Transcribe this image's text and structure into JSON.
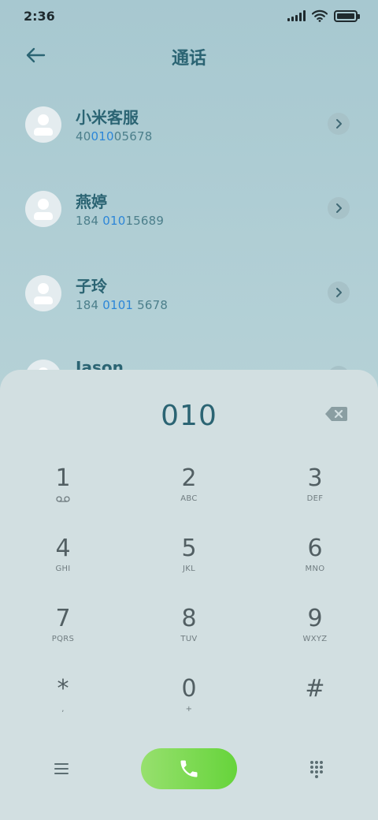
{
  "status_bar": {
    "time": "2:36",
    "icons": [
      "signal-icon",
      "wifi-icon",
      "battery-icon"
    ],
    "signal_bars": 5,
    "battery_level": 1.0
  },
  "header": {
    "title": "通话",
    "back_icon": "arrow-left-icon"
  },
  "contacts": [
    {
      "name": "小米客服",
      "number_parts": [
        "40",
        "010",
        "05678"
      ],
      "highlight_index": 1
    },
    {
      "name": "燕婷",
      "number_parts": [
        "184 ",
        "010",
        "15689"
      ],
      "highlight_index": 1
    },
    {
      "name": "子玲",
      "number_parts": [
        "184 ",
        "0101",
        " 5678"
      ],
      "highlight_index": 1
    },
    {
      "name": "Jason",
      "number_parts": [
        "",
        "",
        ""
      ],
      "highlight_index": 1
    }
  ],
  "dialer": {
    "input": "010",
    "keys": [
      {
        "digit": "1",
        "sub": "",
        "sub_icon": "voicemail-icon"
      },
      {
        "digit": "2",
        "sub": "ABC"
      },
      {
        "digit": "3",
        "sub": "DEF"
      },
      {
        "digit": "4",
        "sub": "GHI"
      },
      {
        "digit": "5",
        "sub": "JKL"
      },
      {
        "digit": "6",
        "sub": "MNO"
      },
      {
        "digit": "7",
        "sub": "PQRS"
      },
      {
        "digit": "8",
        "sub": "TUV"
      },
      {
        "digit": "9",
        "sub": "WXYZ"
      },
      {
        "digit": "*",
        "sub": ","
      },
      {
        "digit": "0",
        "sub": "+"
      },
      {
        "digit": "#",
        "sub": ""
      }
    ]
  },
  "colors": {
    "accent": "#2b6473",
    "highlight": "#2c86d8",
    "call_green": "#66d43b"
  }
}
